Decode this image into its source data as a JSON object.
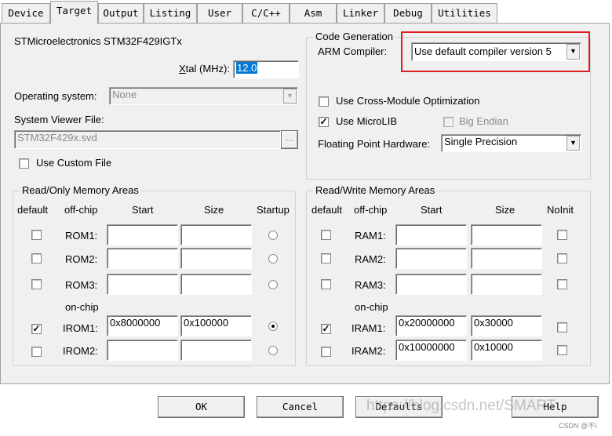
{
  "tabs": [
    {
      "label": "Device",
      "active": false
    },
    {
      "label": "Target",
      "active": true
    },
    {
      "label": "Output",
      "active": false
    },
    {
      "label": "Listing",
      "active": false
    },
    {
      "label": "User",
      "active": false
    },
    {
      "label": "C/C++",
      "active": false
    },
    {
      "label": "Asm",
      "active": false
    },
    {
      "label": "Linker",
      "active": false
    },
    {
      "label": "Debug",
      "active": false
    },
    {
      "label": "Utilities",
      "active": false
    }
  ],
  "device_name": "STMicroelectronics STM32F429IGTx",
  "xtal": {
    "label_prefix": "X",
    "label_rest": "tal (MHz):",
    "value": "12.0"
  },
  "os": {
    "label": "Operating system:",
    "value": "None"
  },
  "svf": {
    "label": "System Viewer File:",
    "value": "STM32F429x.svd",
    "browse": "..."
  },
  "custom_file": {
    "label": "Use Custom File",
    "checked": false
  },
  "codegen": {
    "legend": "Code Generation",
    "compiler_label": "ARM Compiler:",
    "compiler_value": "Use default compiler version 5",
    "cross_module": {
      "label": "Use Cross-Module Optimization",
      "checked": false
    },
    "microlib": {
      "label": "Use MicroLIB",
      "checked": true
    },
    "big_endian": {
      "label": "Big Endian",
      "checked": false
    },
    "fp_label": "Floating Point Hardware:",
    "fp_value": "Single Precision"
  },
  "ro": {
    "legend": "Read/Only Memory Areas",
    "headers": {
      "default": "default",
      "offchip": "off-chip",
      "start": "Start",
      "size": "Size",
      "startup": "Startup"
    },
    "onchip_label": "on-chip",
    "rows": [
      {
        "label": "ROM1:",
        "default": false,
        "start": "",
        "size": "",
        "startup": false
      },
      {
        "label": "ROM2:",
        "default": false,
        "start": "",
        "size": "",
        "startup": false
      },
      {
        "label": "ROM3:",
        "default": false,
        "start": "",
        "size": "",
        "startup": false
      },
      {
        "label": "IROM1:",
        "default": true,
        "start": "0x8000000",
        "size": "0x100000",
        "startup": true
      },
      {
        "label": "IROM2:",
        "default": false,
        "start": "",
        "size": "",
        "startup": false
      }
    ]
  },
  "rw": {
    "legend": "Read/Write Memory Areas",
    "headers": {
      "default": "default",
      "offchip": "off-chip",
      "start": "Start",
      "size": "Size",
      "noinit": "NoInit"
    },
    "onchip_label": "on-chip",
    "rows": [
      {
        "label": "RAM1:",
        "default": false,
        "start": "",
        "size": "",
        "noinit": false
      },
      {
        "label": "RAM2:",
        "default": false,
        "start": "",
        "size": "",
        "noinit": false
      },
      {
        "label": "RAM3:",
        "default": false,
        "start": "",
        "size": "",
        "noinit": false
      },
      {
        "label": "IRAM1:",
        "default": true,
        "start": "0x20000000",
        "size": "0x30000",
        "noinit": false
      },
      {
        "label": "IRAM2:",
        "default": false,
        "start": "0x10000000",
        "size": "0x10000",
        "noinit": false
      }
    ]
  },
  "buttons": {
    "ok": "OK",
    "cancel": "Cancel",
    "defaults": "Defaults",
    "help": "Help"
  },
  "watermark": {
    "main": "https://blog.csdn.net/SMART",
    "corner": "CSDN @不\\"
  },
  "colors": {
    "highlight_box": "#e02020",
    "selection": "#0078d7"
  }
}
